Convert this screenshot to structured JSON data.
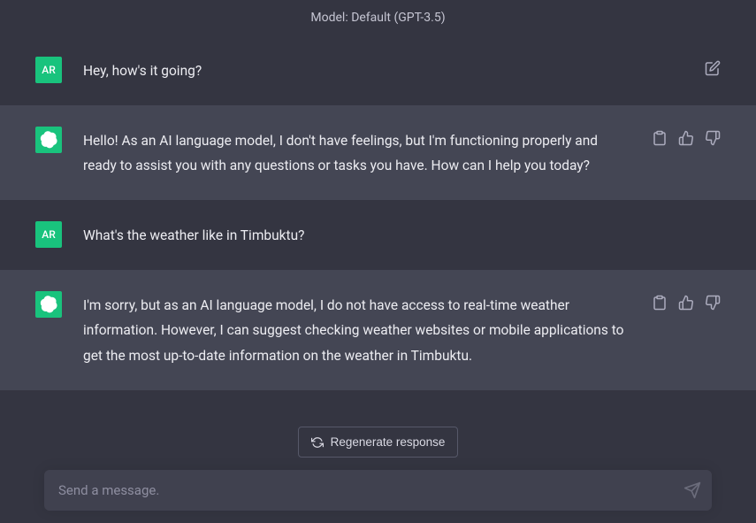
{
  "header": {
    "model_label": "Model: Default (GPT-3.5)"
  },
  "messages": [
    {
      "role": "user",
      "avatar_text": "AR",
      "content": "Hey, how's it going?"
    },
    {
      "role": "assistant",
      "avatar_text": "",
      "content": "Hello! As an AI language model, I don't have feelings, but I'm functioning properly and ready to assist you with any questions or tasks you have. How can I help you today?"
    },
    {
      "role": "user",
      "avatar_text": "AR",
      "content": "What's the weather like in Timbuktu?"
    },
    {
      "role": "assistant",
      "avatar_text": "",
      "content": "I'm sorry, but as an AI language model, I do not have access to real-time weather information. However, I can suggest checking weather websites or mobile applications to get the most up-to-date information on the weather in Timbuktu."
    }
  ],
  "controls": {
    "regenerate_label": "Regenerate response",
    "input_placeholder": "Send a message."
  }
}
